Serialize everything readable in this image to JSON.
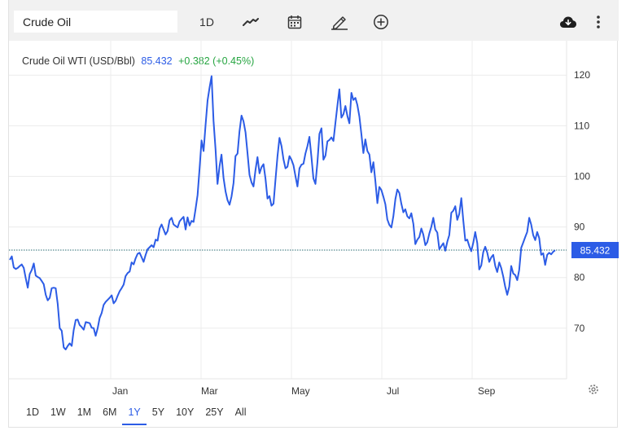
{
  "toolbar": {
    "search_value": "Crude Oil",
    "interval_label": "1D",
    "icons": [
      "line-chart-icon",
      "calendar-icon",
      "pencil-icon",
      "add-circle-icon",
      "cloud-download-icon",
      "more-vertical-icon"
    ]
  },
  "header": {
    "name": "Crude Oil WTI (USD/Bbl)",
    "price": "85.432",
    "change": "+0.382 (+0.45%)"
  },
  "last_label": "85.432",
  "ranges": [
    {
      "label": "1D",
      "active": false
    },
    {
      "label": "1W",
      "active": false
    },
    {
      "label": "1M",
      "active": false
    },
    {
      "label": "6M",
      "active": false
    },
    {
      "label": "1Y",
      "active": true
    },
    {
      "label": "5Y",
      "active": false
    },
    {
      "label": "10Y",
      "active": false
    },
    {
      "label": "25Y",
      "active": false
    },
    {
      "label": "All",
      "active": false
    }
  ],
  "colors": {
    "line": "#2c5ce6",
    "price_up": "#26a541",
    "grid": "#ececec",
    "last_bg": "#2c5ce6"
  },
  "chart_data": {
    "type": "line",
    "title": "",
    "series": [
      {
        "name": "Crude Oil WTI (USD/Bbl)",
        "values": [
          83.5,
          84.2,
          82.0,
          81.7,
          81.9,
          82.3,
          82.6,
          81.9,
          79.9,
          78.0,
          80.7,
          81.5,
          82.8,
          80.4,
          80.1,
          79.9,
          79.3,
          78.7,
          76.6,
          75.5,
          76.0,
          77.9,
          78.0,
          77.9,
          74.8,
          70.0,
          69.5,
          66.2,
          65.8,
          66.5,
          67.0,
          66.5,
          69.6,
          71.6,
          71.7,
          70.6,
          70.2,
          69.7,
          71.2,
          71.1,
          71.0,
          70.1,
          70.0,
          68.5,
          70.0,
          72.0,
          73.0,
          74.6,
          75.2,
          75.6,
          76.0,
          76.5,
          74.9,
          75.4,
          76.4,
          77.3,
          77.9,
          78.6,
          80.3,
          80.9,
          81.2,
          83.0,
          82.6,
          83.8,
          84.7,
          84.9,
          84.0,
          83.1,
          84.5,
          85.6,
          86.0,
          86.4,
          86.0,
          87.5,
          87.3,
          89.7,
          90.5,
          89.5,
          88.5,
          89.2,
          91.3,
          91.8,
          90.5,
          90.2,
          89.9,
          91.1,
          91.6,
          92.0,
          89.5,
          91.9,
          90.3,
          91.2,
          91.0,
          93.5,
          96.3,
          101.6,
          107.1,
          105.0,
          110.1,
          115.0,
          117.5,
          119.8,
          111.0,
          105.3,
          98.5,
          102.0,
          104.3,
          99.7,
          97.0,
          95.3,
          94.4,
          96.0,
          98.7,
          104.0,
          104.5,
          108.9,
          112.0,
          110.9,
          108.7,
          104.5,
          100.3,
          98.8,
          98.0,
          101.3,
          103.8,
          100.6,
          101.8,
          102.4,
          99.6,
          95.6,
          96.1,
          94.2,
          94.6,
          99.3,
          104.0,
          107.6,
          106.0,
          103.4,
          101.6,
          101.9,
          104.0,
          103.3,
          102.2,
          100.0,
          98.0,
          101.6,
          102.3,
          102.5,
          104.5,
          106.0,
          107.8,
          103.8,
          99.6,
          98.5,
          102.7,
          108.4,
          109.5,
          103.3,
          104.1,
          106.9,
          107.2,
          107.7,
          107.0,
          110.5,
          114.0,
          117.2,
          111.6,
          112.3,
          113.9,
          111.9,
          110.5,
          116.5,
          115.1,
          115.5,
          114.1,
          111.8,
          108.4,
          104.6,
          107.3,
          105.0,
          104.3,
          100.8,
          102.8,
          99.1,
          94.7,
          97.9,
          97.3,
          96.0,
          94.5,
          91.5,
          90.4,
          89.9,
          92.1,
          95.5,
          97.4,
          96.7,
          94.6,
          92.9,
          93.5,
          92.1,
          91.7,
          92.7,
          90.6,
          86.6,
          87.5,
          88.0,
          89.7,
          88.5,
          86.4,
          87.0,
          88.7,
          90.0,
          91.8,
          89.5,
          88.9,
          85.6,
          86.2,
          86.8,
          85.3,
          87.1,
          88.4,
          92.8,
          93.2,
          94.1,
          91.4,
          92.6,
          95.7,
          91.3,
          87.3,
          87.5,
          86.2,
          85.2,
          86.9,
          89.0,
          86.8,
          81.6,
          82.4,
          85.0,
          86.1,
          84.9,
          83.1,
          84.0,
          84.5,
          82.3,
          81.1,
          83.0,
          81.9,
          80.2,
          78.2,
          76.6,
          78.2,
          82.3,
          80.8,
          80.5,
          79.5,
          81.5,
          85.9,
          86.9,
          88.0,
          89.0,
          91.8,
          90.5,
          88.4,
          87.4,
          89.0,
          87.8,
          84.5,
          84.8,
          82.5,
          84.5,
          84.9,
          84.6,
          85.1,
          85.4
        ]
      }
    ],
    "x_tick_labels": [
      "Jan",
      "Mar",
      "May",
      "Jul",
      "Sep"
    ],
    "y_ticks": [
      70,
      80,
      90,
      100,
      110,
      120
    ],
    "ylim": [
      60,
      126.8
    ],
    "grid": true,
    "last_value": 85.432
  }
}
